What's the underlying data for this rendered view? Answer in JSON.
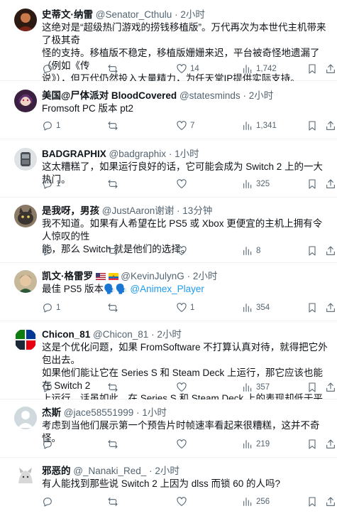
{
  "tweets": [
    {
      "name": "史蒂文·纳雷",
      "handle": "@Senator_Cthulu",
      "dot": "·",
      "time": "2小时",
      "text": "这绝对是“超级热门游戏的捞钱移植版”。万代再次为本世代主机带来了极其奇怪的支持。移植版不稳定，移植版姗姗来迟，平台被奇怪地遗漏了（例如《传说》），但万代仍然投入大量精力，为任天堂IP提供实际支持。",
      "text_lines": [
        "这绝对是“超级热门游戏的捞钱移植版”。万代再次为本世代主机带来了极其奇",
        "怪的支持。移植版不稳定，移植版姗姗来迟，平台被奇怪地遗漏了（例如《传",
        "说》），但万代仍然投入大量精力，为任天堂IP提供实际支持。"
      ],
      "replies": "",
      "retweets": "",
      "likes": "14",
      "views": "1,742"
    },
    {
      "name": "美国@尸体派对 BloodCovered",
      "handle": "@statesminds",
      "dot": "·",
      "time": "2小时",
      "text_lines": [
        "Fromsoft PC 版本 pt2"
      ],
      "replies": "1",
      "retweets": "",
      "likes": "7",
      "views": "1,341"
    },
    {
      "name": "BADGRAPHIX",
      "handle": "@badgraphix",
      "dot": "·",
      "time": "1小时",
      "text_lines": [
        "这太糟糕了，如果运行良好的话，它可能会成为 Switch 2 上的一大热门。"
      ],
      "replies": "1",
      "retweets": "",
      "likes": "",
      "views": "325"
    },
    {
      "name": "是我呀，男孩",
      "handle": "@JustAaron谢谢",
      "dot": "·",
      "time": "13分钟",
      "text_lines": [
        "我不知道。如果有人希望在比 PS5 或 Xbox 更便宜的主机上拥有令人惊叹的性",
        "能，那么 Switch 就是他们的选择。"
      ],
      "replies": "",
      "retweets": "",
      "likes": "",
      "views": "8"
    },
    {
      "name": "凯文·格雷罗",
      "handle": "@KevinJulynG",
      "dot": "·",
      "time": "2小时",
      "text_main": "最佳 PS5 版本",
      "emoji": "🗣️🗣️",
      "mention": "@Animex_Player",
      "replies": "1",
      "retweets": "",
      "likes": "1",
      "views": "354"
    },
    {
      "name": "Chicon_81",
      "handle": "@Chicon_81",
      "dot": "·",
      "time": "2小时",
      "text_lines": [
        "这是个优化问题，如果 FromSoftware 不打算认真对待，就得把它外包出去。",
        "如果他们能让它在 Series S 和 Steam Deck 上运行，那它应该也能在 Switch 2",
        "上运行。话虽如此，在 Series S 和 Steam Deck 上的表现却低于平均水平。"
      ],
      "replies": "",
      "retweets": "",
      "likes": "",
      "views": "357"
    },
    {
      "name": "杰斯",
      "handle": "@jace58551999",
      "dot": "·",
      "time": "1小时",
      "text_lines": [
        "考虑到当他们展示第一个预告片时帧速率看起来很糟糕，这并不奇怪。"
      ],
      "replies": "",
      "retweets": "",
      "likes": "",
      "views": "219"
    },
    {
      "name": "邪恶的",
      "handle": "@_Nanaki_Red_",
      "dot": "·",
      "time": "2小时",
      "text_lines": [
        "有人能找到那些说 Switch 2 上因为 dlss 而锁 60 的人吗?"
      ],
      "replies": "",
      "retweets": "",
      "likes": "",
      "views": "256"
    }
  ],
  "icons": {
    "reply": "reply-icon",
    "retweet": "retweet-icon",
    "like": "heart-icon",
    "views": "views-chart-icon",
    "bookmark": "bookmark-icon",
    "share": "share-icon"
  },
  "colors": {
    "text": "#0f1419",
    "secondary": "#536471",
    "link": "#1d9bf0",
    "divider": "#eff3f4"
  }
}
